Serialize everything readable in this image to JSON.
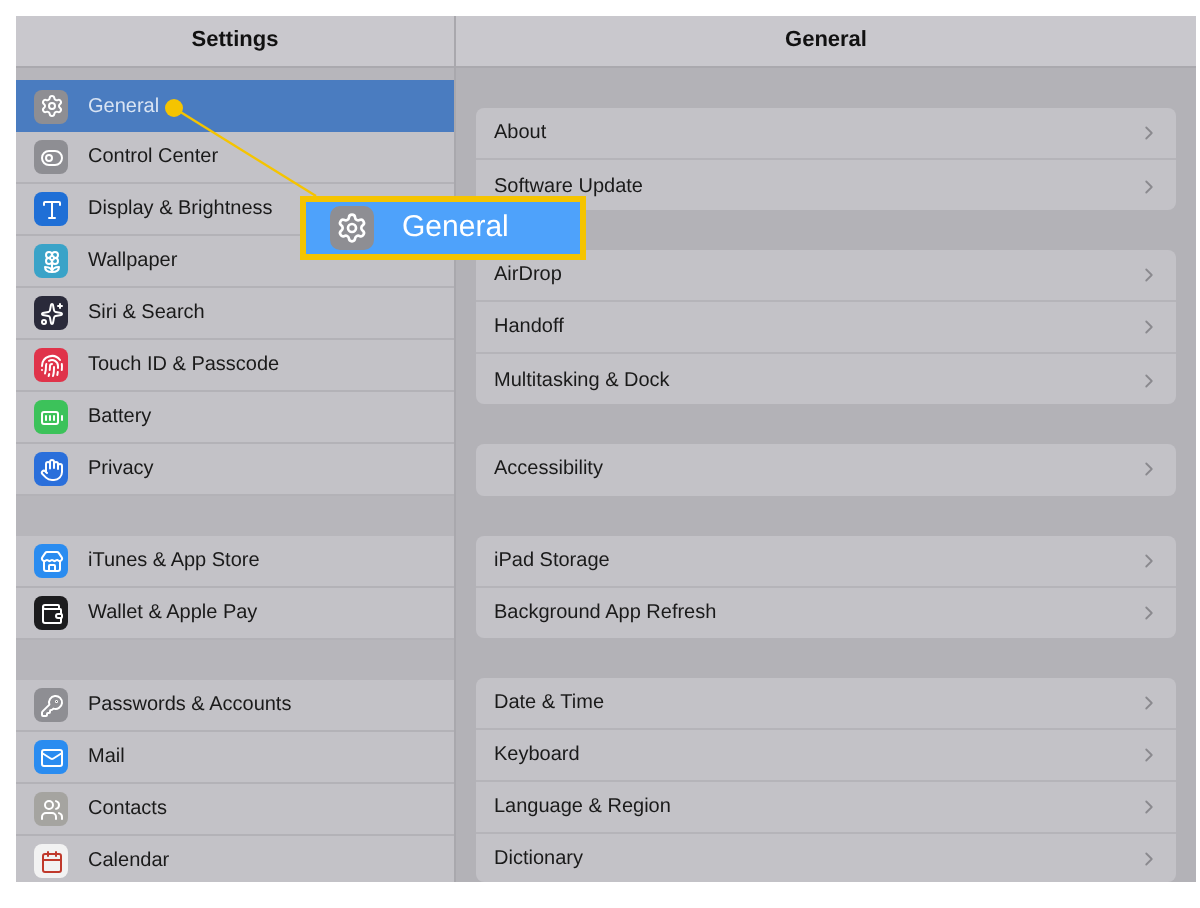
{
  "sidebar": {
    "title": "Settings",
    "groups": [
      [
        {
          "label": "General",
          "selected": true,
          "color": "#8e8e93"
        },
        {
          "label": "Control Center",
          "selected": false,
          "color": "#8e8e93"
        },
        {
          "label": "Display & Brightness",
          "selected": false,
          "color": "#1f6fd6"
        },
        {
          "label": "Wallpaper",
          "selected": false,
          "color": "#3aa3c8"
        },
        {
          "label": "Siri & Search",
          "selected": false,
          "color": "#2a2a3a"
        },
        {
          "label": "Touch ID & Passcode",
          "selected": false,
          "color": "#e0334a"
        },
        {
          "label": "Battery",
          "selected": false,
          "color": "#3cc25a"
        },
        {
          "label": "Privacy",
          "selected": false,
          "color": "#2a6fdb"
        }
      ],
      [
        {
          "label": "iTunes & App Store",
          "selected": false,
          "color": "#2a8cf0"
        },
        {
          "label": "Wallet & Apple Pay",
          "selected": false,
          "color": "#1c1c1e"
        }
      ],
      [
        {
          "label": "Passwords & Accounts",
          "selected": false,
          "color": "#8e8e93"
        },
        {
          "label": "Mail",
          "selected": false,
          "color": "#2a8cf0"
        },
        {
          "label": "Contacts",
          "selected": false,
          "color": "#a5a4a0"
        },
        {
          "label": "Calendar",
          "selected": false,
          "color": "#f2f2f2"
        }
      ]
    ]
  },
  "detail": {
    "title": "General",
    "groups": [
      [
        "About",
        "Software Update"
      ],
      [
        "AirDrop",
        "Handoff",
        "Multitasking & Dock"
      ],
      [
        "Accessibility"
      ],
      [
        "iPad Storage",
        "Background App Refresh"
      ],
      [
        "Date & Time",
        "Keyboard",
        "Language & Region",
        "Dictionary"
      ]
    ]
  },
  "callout": {
    "label": "General"
  }
}
